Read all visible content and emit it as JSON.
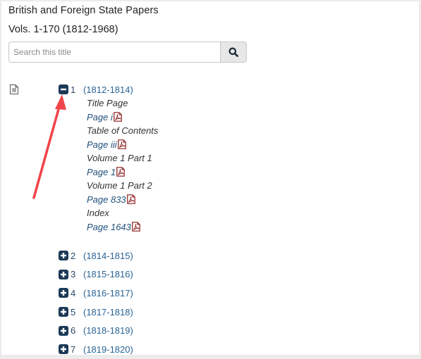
{
  "header": {
    "title": "British and Foreign State Papers",
    "subtitle": "Vols. 1-170 (1812-1968)"
  },
  "search": {
    "placeholder": "Search this title",
    "value": "",
    "button_icon": "search-icon"
  },
  "tree": {
    "expanded": {
      "number": "1",
      "years": "(1812-1814)",
      "toggle_icon": "minus-square-icon",
      "items": [
        {
          "label": "Title Page",
          "type": "heading"
        },
        {
          "label": "Page i",
          "type": "link",
          "icon": "pdf-icon"
        },
        {
          "label": "Table of Contents",
          "type": "heading"
        },
        {
          "label": "Page iii",
          "type": "link",
          "icon": "pdf-icon"
        },
        {
          "label": "Volume 1 Part 1",
          "type": "heading"
        },
        {
          "label": "Page 1",
          "type": "link",
          "icon": "pdf-icon"
        },
        {
          "label": "Volume 1 Part 2",
          "type": "heading"
        },
        {
          "label": "Page 833",
          "type": "link",
          "icon": "pdf-icon"
        },
        {
          "label": "Index",
          "type": "heading"
        },
        {
          "label": "Page 1643",
          "type": "link",
          "icon": "pdf-icon"
        }
      ]
    },
    "collapsed": [
      {
        "number": "2",
        "years": "(1814-1815)",
        "toggle_icon": "plus-square-icon"
      },
      {
        "number": "3",
        "years": "(1815-1816)",
        "toggle_icon": "plus-square-icon"
      },
      {
        "number": "4",
        "years": "(1816-1817)",
        "toggle_icon": "plus-square-icon"
      },
      {
        "number": "5",
        "years": "(1817-1818)",
        "toggle_icon": "plus-square-icon"
      },
      {
        "number": "6",
        "years": "(1818-1819)",
        "toggle_icon": "plus-square-icon"
      },
      {
        "number": "7",
        "years": "(1819-1820)",
        "toggle_icon": "plus-square-icon"
      }
    ]
  },
  "annotation": {
    "type": "arrow",
    "color": "#f0444a",
    "points_to": "minus-square-icon"
  },
  "colors": {
    "toggle": "#1c3a57",
    "link": "#23527c",
    "pdf": "#8b1a1a"
  }
}
